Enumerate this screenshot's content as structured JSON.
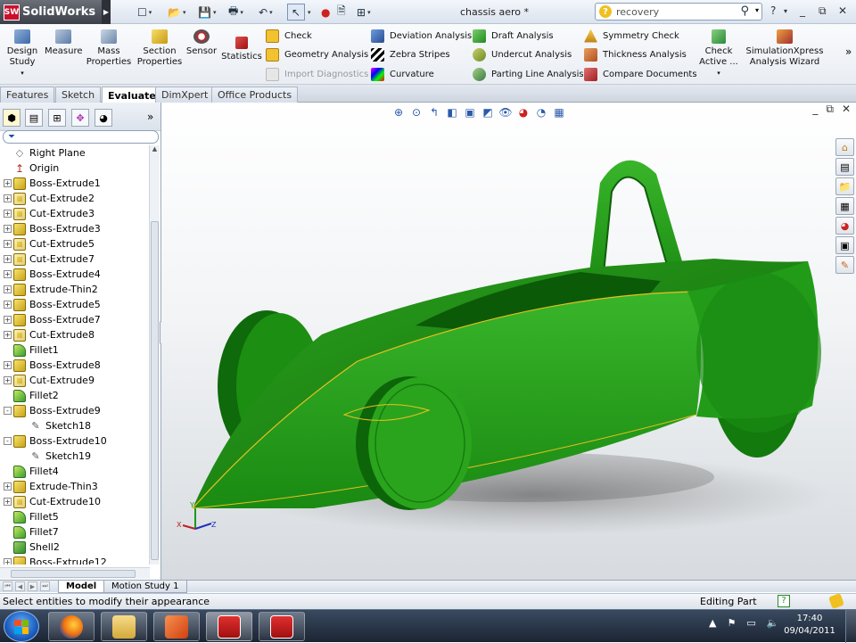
{
  "app": {
    "name": "SolidWorks",
    "document_title": "chassis aero *",
    "logo_text": "SW"
  },
  "search": {
    "value": "recovery"
  },
  "ribbon": {
    "big": [
      {
        "label": "Design Study",
        "icon": "design-study-icon"
      },
      {
        "label": "Measure",
        "icon": "measure-icon"
      },
      {
        "label": "Mass Properties",
        "icon": "mass-properties-icon"
      },
      {
        "label": "Section Properties",
        "icon": "section-properties-icon"
      },
      {
        "label": "Sensor",
        "icon": "sensor-icon"
      },
      {
        "label": "Statistics",
        "icon": "statistics-icon"
      }
    ],
    "col1": [
      "Check",
      "Geometry Analysis",
      "Import Diagnostics"
    ],
    "col2": [
      "Deviation Analysis",
      "Zebra Stripes",
      "Curvature"
    ],
    "col3": [
      "Draft Analysis",
      "Undercut Analysis",
      "Parting Line Analysis"
    ],
    "col4": [
      "Symmetry Check",
      "Thickness Analysis",
      "Compare Documents"
    ],
    "check_active": "Check Active ...",
    "simxpress": "SimulationXpress Analysis Wizard"
  },
  "tabs": [
    "Features",
    "Sketch",
    "Evaluate",
    "DimXpert",
    "Office Products"
  ],
  "active_tab": "Evaluate",
  "tree": [
    {
      "label": "Right Plane",
      "type": "plane",
      "exp": ""
    },
    {
      "label": "Origin",
      "type": "origin",
      "exp": ""
    },
    {
      "label": "Boss-Extrude1",
      "type": "feat",
      "exp": "+"
    },
    {
      "label": "Cut-Extrude2",
      "type": "cut",
      "exp": "+"
    },
    {
      "label": "Cut-Extrude3",
      "type": "cut",
      "exp": "+"
    },
    {
      "label": "Boss-Extrude3",
      "type": "feat",
      "exp": "+"
    },
    {
      "label": "Cut-Extrude5",
      "type": "cut",
      "exp": "+"
    },
    {
      "label": "Cut-Extrude7",
      "type": "cut",
      "exp": "+"
    },
    {
      "label": "Boss-Extrude4",
      "type": "feat",
      "exp": "+"
    },
    {
      "label": "Extrude-Thin2",
      "type": "feat",
      "exp": "+"
    },
    {
      "label": "Boss-Extrude5",
      "type": "feat",
      "exp": "+"
    },
    {
      "label": "Boss-Extrude7",
      "type": "feat",
      "exp": "+"
    },
    {
      "label": "Cut-Extrude8",
      "type": "cut",
      "exp": "+"
    },
    {
      "label": "Fillet1",
      "type": "fil",
      "exp": ""
    },
    {
      "label": "Boss-Extrude8",
      "type": "feat",
      "exp": "+"
    },
    {
      "label": "Cut-Extrude9",
      "type": "cut",
      "exp": "+"
    },
    {
      "label": "Fillet2",
      "type": "fil",
      "exp": ""
    },
    {
      "label": "Boss-Extrude9",
      "type": "feat",
      "exp": "-"
    },
    {
      "label": "Sketch18",
      "type": "sk",
      "exp": "",
      "indent": 1
    },
    {
      "label": "Boss-Extrude10",
      "type": "feat",
      "exp": "-"
    },
    {
      "label": "Sketch19",
      "type": "sk",
      "exp": "",
      "indent": 1
    },
    {
      "label": "Fillet4",
      "type": "fil",
      "exp": ""
    },
    {
      "label": "Extrude-Thin3",
      "type": "feat",
      "exp": "+"
    },
    {
      "label": "Cut-Extrude10",
      "type": "cut",
      "exp": "+"
    },
    {
      "label": "Fillet5",
      "type": "fil",
      "exp": ""
    },
    {
      "label": "Fillet7",
      "type": "fil",
      "exp": ""
    },
    {
      "label": "Shell2",
      "type": "shell",
      "exp": ""
    },
    {
      "label": "Boss-Extrude12",
      "type": "feat",
      "exp": "+"
    }
  ],
  "bottom_tabs": [
    "Model",
    "Motion Study 1"
  ],
  "status": {
    "message": "Select entities to modify their appearance",
    "mode": "Editing Part"
  },
  "clock": {
    "time": "17:40",
    "date": "09/04/2011"
  },
  "colors": {
    "model_green": "#1f9a14",
    "model_dark": "#0d5e0a",
    "edge_yellow": "#e8c020"
  }
}
